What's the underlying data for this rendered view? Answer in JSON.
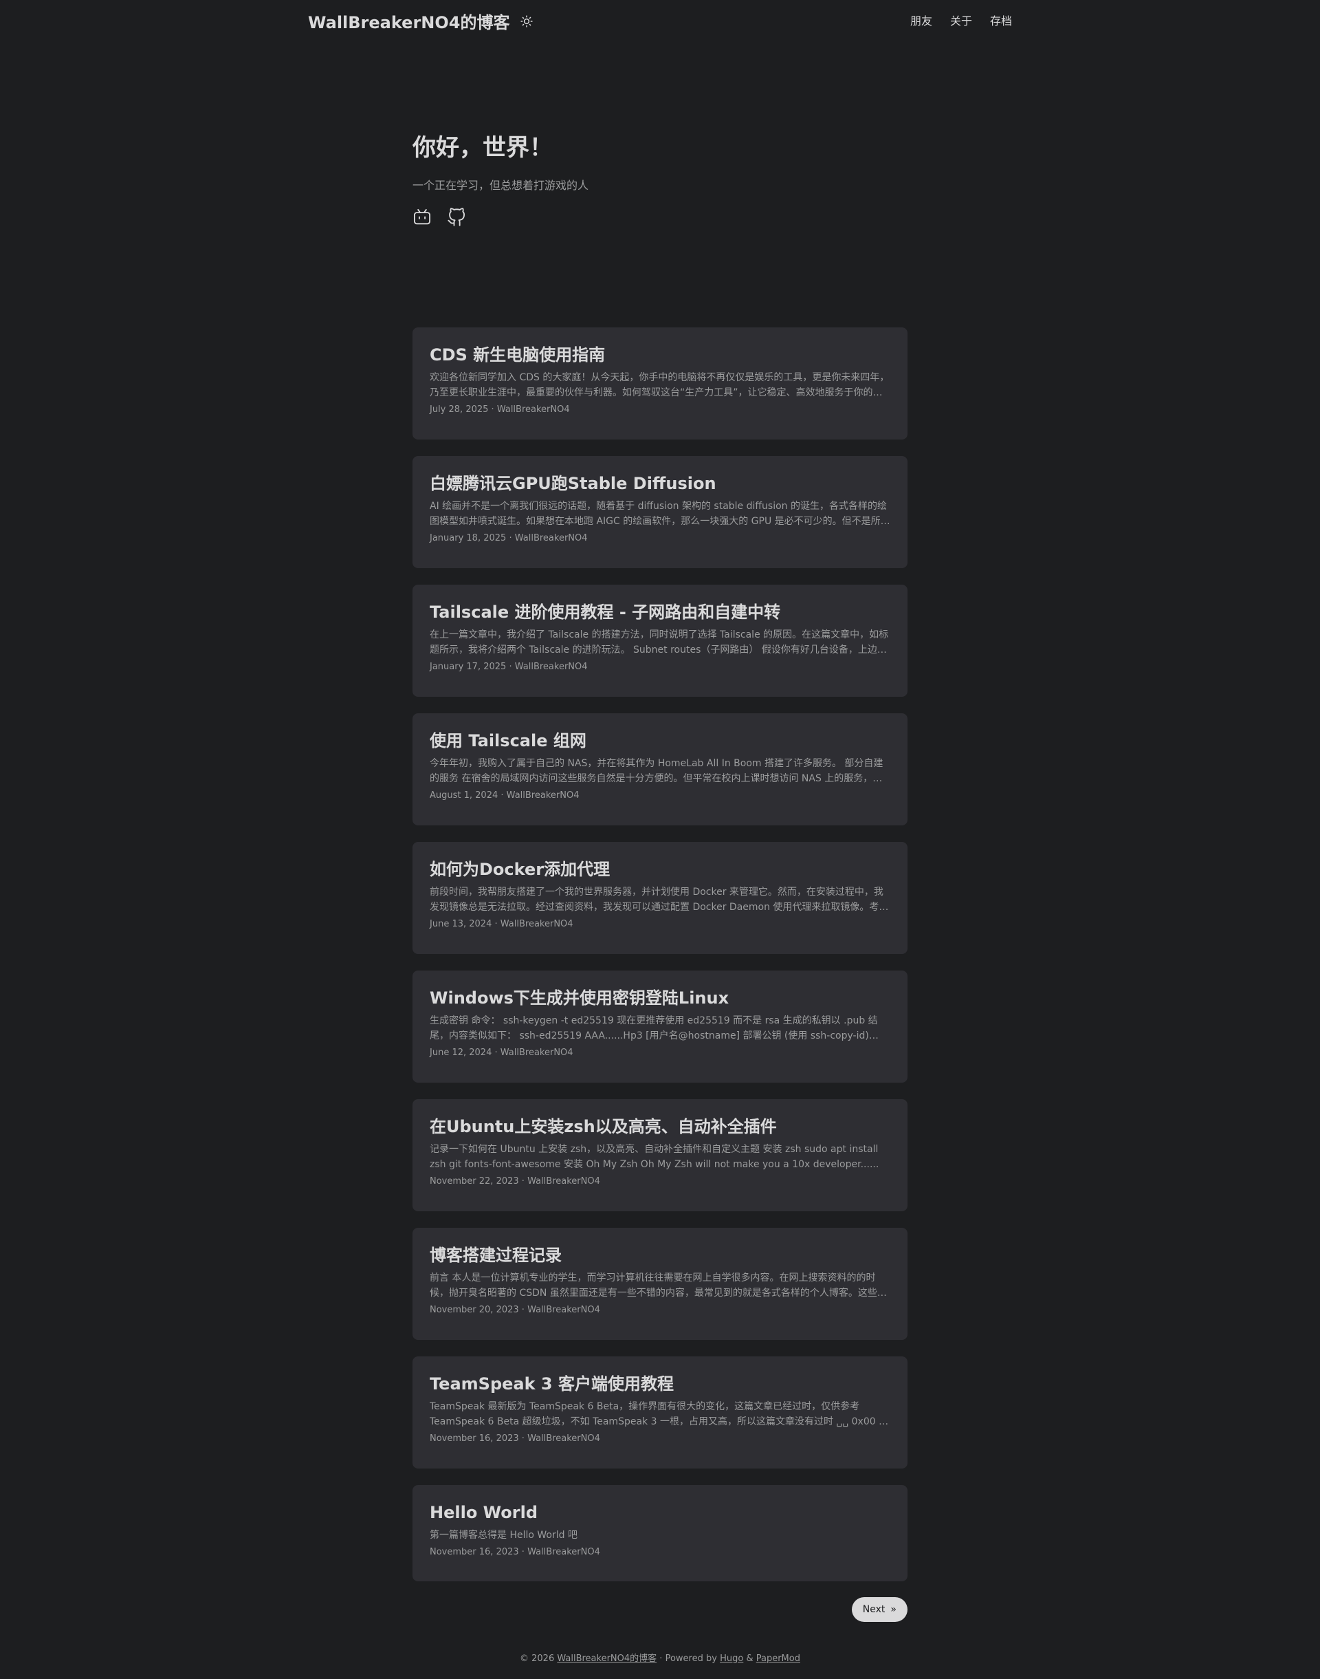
{
  "header": {
    "site_title": "WallBreakerNO4的博客",
    "menu": [
      {
        "label": "朋友"
      },
      {
        "label": "关于"
      },
      {
        "label": "存档"
      }
    ]
  },
  "home": {
    "title": "你好，世界！",
    "subtitle": "一个正在学习，但总想着打游戏的人",
    "social": [
      "bilibili-icon",
      "github-icon"
    ]
  },
  "posts": [
    {
      "title": "CDS 新生电脑使用指南",
      "excerpt": "欢迎各位新同学加入 CDS 的大家庭！从今天起，你手中的电脑将不再仅仅是娱乐的工具，更是你未来四年，乃至更长职业生涯中，最重要的伙伴与利器。如何驾驭这台“生产力工具”，让它稳定、高效地服务于你的…",
      "date": "July 28, 2025",
      "author": "WallBreakerNO4"
    },
    {
      "title": "白嫖腾讯云GPU跑Stable Diffusion",
      "excerpt": "AI 绘画并不是一个离我们很远的话题，随着基于 diffusion 架构的 stable diffusion 的诞生，各式各样的绘图模型如井喷式诞生。如果想在本地跑 AIGC 的绘画软件，那么一块强大的 GPU 是必不可少的。但不是所…",
      "date": "January 18, 2025",
      "author": "WallBreakerNO4"
    },
    {
      "title": "Tailscale 进阶使用教程 - 子网路由和自建中转",
      "excerpt": "在上一篇文章中，我介绍了 Tailscale 的搭建方法，同时说明了选择 Tailscale 的原因。在这篇文章中，如标题所示，我将介绍两个 Tailscale 的进阶玩法。 Subnet routes（子网路由） 假设你有好几台设备，上边…",
      "date": "January 17, 2025",
      "author": "WallBreakerNO4"
    },
    {
      "title": "使用 Tailscale 组网",
      "excerpt": "今年年初，我购入了属于自己的 NAS，并在将其作为 HomeLab All In Boom 搭建了许多服务。 部分自建的服务 在宿舍的局域网内访问这些服务自然是十分方便的。但平常在校内上课时想访问 NAS 上的服务，…",
      "date": "August 1, 2024",
      "author": "WallBreakerNO4"
    },
    {
      "title": "如何为Docker添加代理",
      "excerpt": "前段时间，我帮朋友搭建了一个我的世界服务器，并计划使用 Docker 来管理它。然而，在安装过程中，我发现镜像总是无法拉取。经过查阅资料，我发现可以通过配置 Docker Daemon 使用代理来拉取镜像。考…",
      "date": "June 13, 2024",
      "author": "WallBreakerNO4"
    },
    {
      "title": "Windows下生成并使用密钥登陆Linux",
      "excerpt": "生成密钥 命令： ssh-keygen -t ed25519 现在更推荐使用 ed25519 而不是 rsa 生成的私钥以 .pub 结尾，内容类似如下： ssh-ed25519 AAA......Hp3 [用户名@hostname] 部署公钥 (使用 ssh-copy-id)…",
      "date": "June 12, 2024",
      "author": "WallBreakerNO4"
    },
    {
      "title": "在Ubuntu上安装zsh以及高亮、自动补全插件",
      "excerpt": "记录一下如何在 Ubuntu 上安装 zsh，以及高亮、自动补全插件和自定义主题 安装 zsh sudo apt install zsh git fonts-font-awesome 安装 Oh My Zsh Oh My Zsh will not make you a 10x developer......",
      "date": "November 22, 2023",
      "author": "WallBreakerNO4"
    },
    {
      "title": "博客搭建过程记录",
      "excerpt": "前言 本人是一位计算机专业的学生，而学习计算机往往需要在网上自学很多内容。在网上搜索资料的的时候，抛开臭名昭著的 CSDN 虽然里面还是有一些不错的内容，最常见到的就是各式各样的个人博客。这些…",
      "date": "November 20, 2023",
      "author": "WallBreakerNO4"
    },
    {
      "title": "TeamSpeak 3 客户端使用教程",
      "excerpt": "TeamSpeak 最新版为 TeamSpeak 6 Beta，操作界面有很大的变化，这篇文章已经过时，仅供参考 TeamSpeak 6 Beta 超级垃圾，不如 TeamSpeak 3 一根，占用又高，所以这篇文章没有过时 ␣␣ 0x00 …",
      "date": "November 16, 2023",
      "author": "WallBreakerNO4"
    },
    {
      "title": "Hello World",
      "excerpt": "第一篇博客总得是 Hello World 吧",
      "date": "November 16, 2023",
      "author": "WallBreakerNO4"
    }
  ],
  "meta_separator": "·",
  "pagination": {
    "next_label": "Next",
    "next_arrow": "»"
  },
  "footer": {
    "prefix": "© 2026",
    "site_link": "WallBreakerNO4的博客",
    "sep": "·",
    "powered_by": "Powered by",
    "hugo": "Hugo",
    "amp": "&",
    "theme": "PaperMod"
  },
  "colors": {
    "background": "#1d1e20",
    "card": "#2e2e33",
    "primary_text": "#dadadb",
    "secondary_text": "#9b9c9d"
  }
}
